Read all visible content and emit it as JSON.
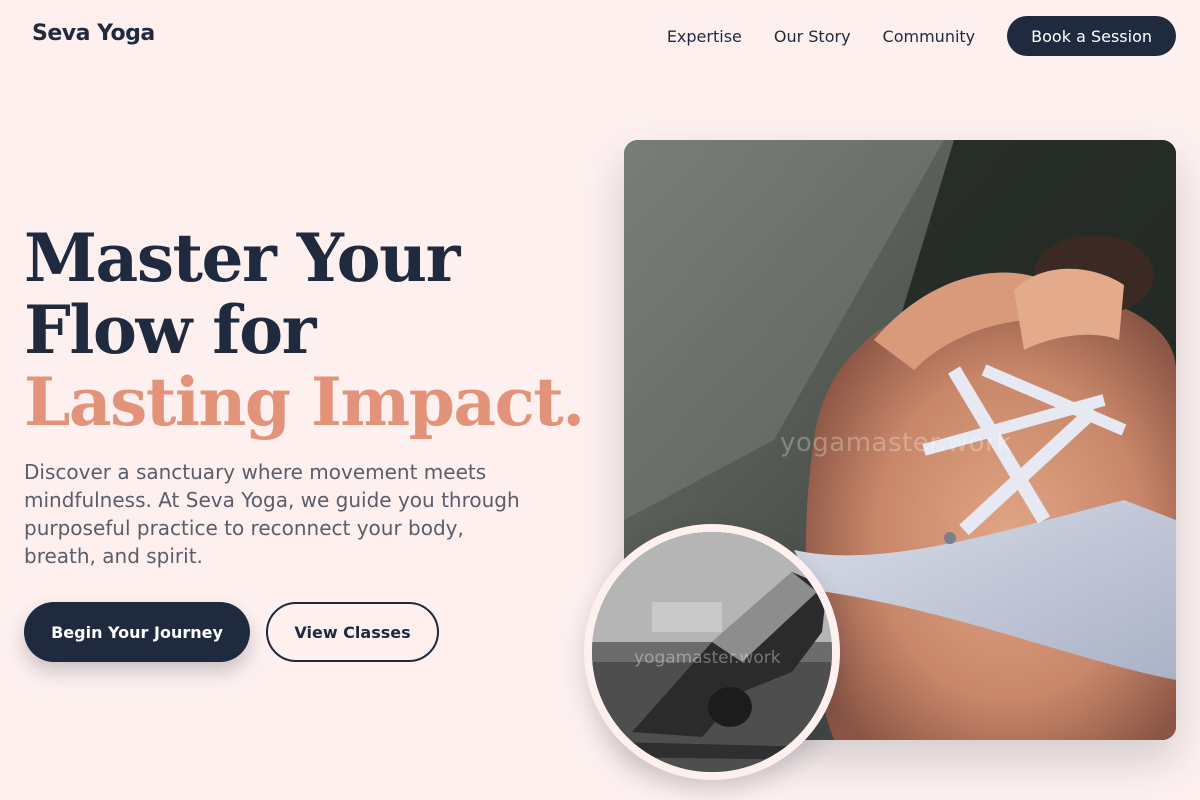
{
  "header": {
    "brand": "Seva Yoga",
    "nav": [
      {
        "label": "Expertise"
      },
      {
        "label": "Our Story"
      },
      {
        "label": "Community"
      }
    ],
    "cta_label": "Book a Session"
  },
  "hero": {
    "headline_part1": "Master Your Flow for ",
    "headline_accent": "Lasting Impact.",
    "description": "Discover a sanctuary where movement meets mindfulness. At Seva Yoga, we guide you through purposeful practice to reconnect your body, breath, and spirit.",
    "primary_button": "Begin Your Journey",
    "secondary_button": "View Classes"
  },
  "images": {
    "main_watermark": "yogamaster.work",
    "circle_watermark": "yogamaster.work"
  },
  "colors": {
    "background": "#fdf0ef",
    "navy": "#1f2a3e",
    "accent": "#e2937a"
  }
}
